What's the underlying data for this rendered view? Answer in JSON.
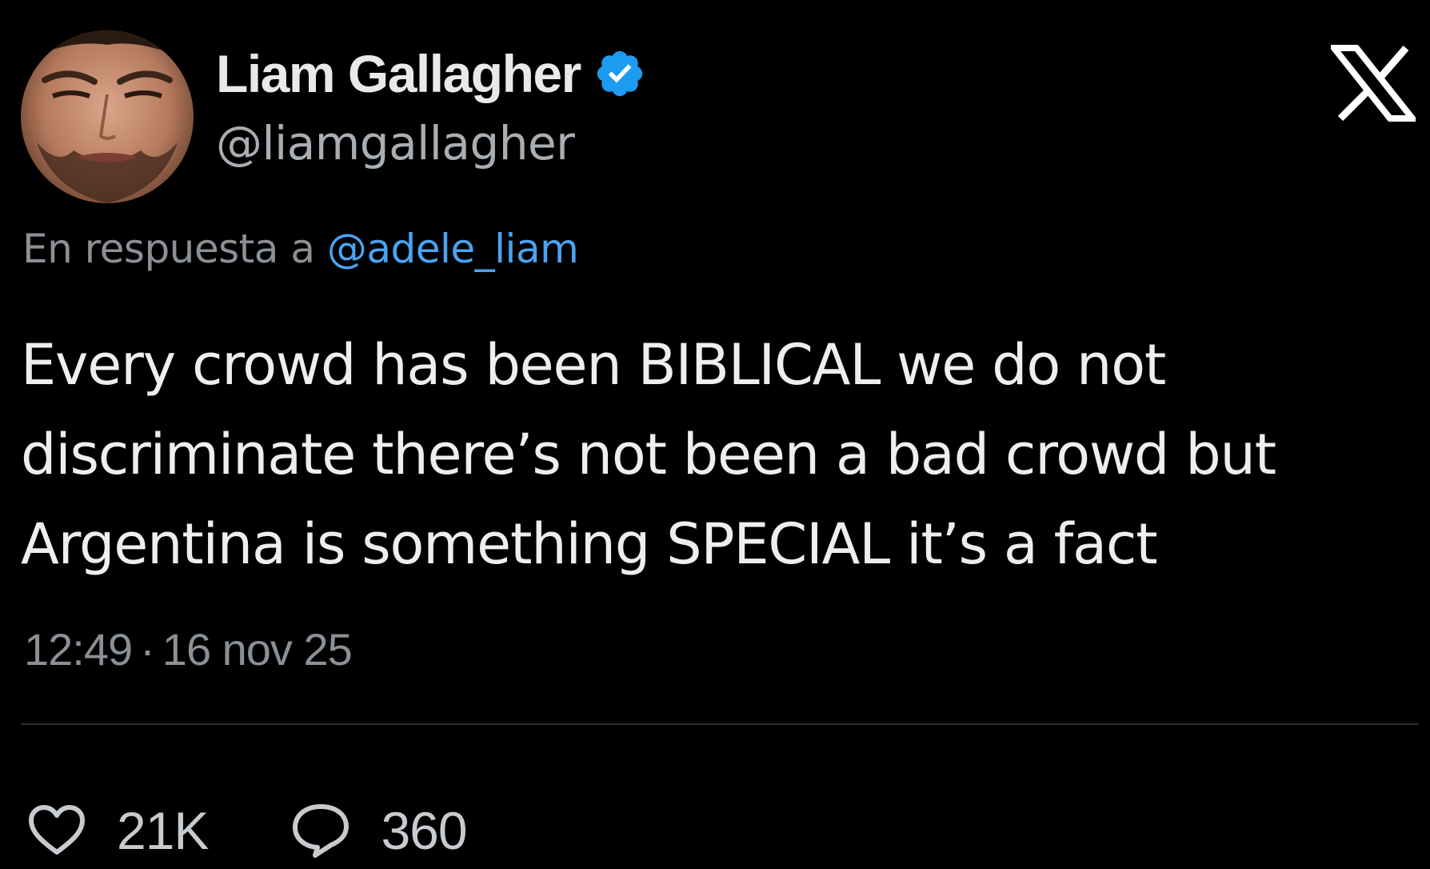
{
  "tweet": {
    "author": {
      "display_name": "Liam Gallagher",
      "handle": "@liamgallagher",
      "verified_icon": "verified-badge-icon",
      "avatar": "profile-photo"
    },
    "platform_icon": "x-logo-icon",
    "reply": {
      "prefix": "En respuesta a",
      "mention": "@adele_liam"
    },
    "text_lines": [
      "Every crowd has been BIBLICAL we do not",
      "discriminate there’s not been a bad crowd but",
      "Argentina is something SPECIAL it’s a fact"
    ],
    "time": "12:49",
    "separator": "·",
    "date": "16 nov 25",
    "actions": {
      "likes": {
        "icon": "heart-icon",
        "count": "21K"
      },
      "replies": {
        "icon": "comment-bubble-icon",
        "count": "360"
      }
    }
  },
  "colors": {
    "background": "#000000",
    "primary_text": "#e7e9ea",
    "secondary_text": "#8b9096",
    "mention": "#4aa3f0",
    "verified": "#1d9bf0",
    "divider": "#2b2f33"
  }
}
